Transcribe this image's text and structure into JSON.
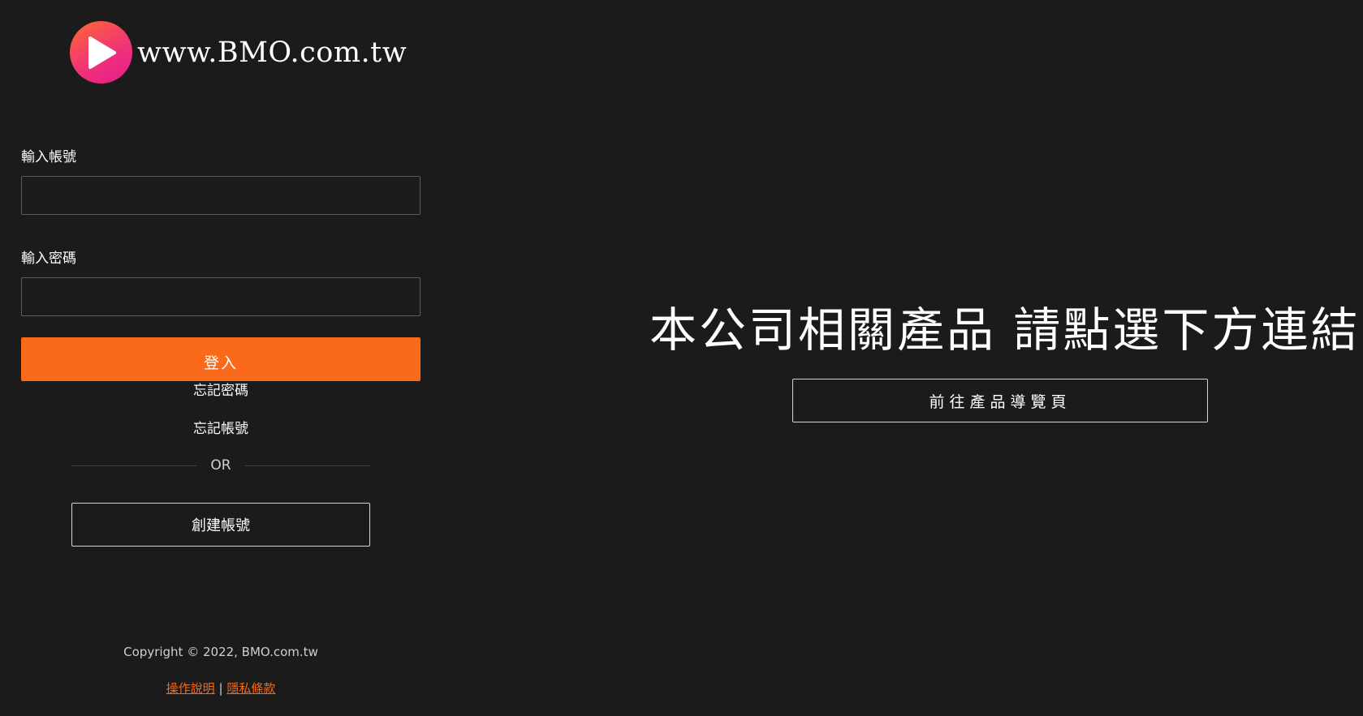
{
  "brand": {
    "logo_icon": "play-icon",
    "site_name": "www.BMO.com.tw"
  },
  "login": {
    "account_label": "輸入帳號",
    "account_value": "",
    "password_label": "輸入密碼",
    "password_value": "",
    "login_button": "登入",
    "forgot_password": "忘記密碼",
    "forgot_account": "忘記帳號",
    "or_text": "OR",
    "create_account_button": "創建帳號"
  },
  "footer": {
    "copyright": "Copyright © 2022, BMO.com.tw",
    "manual_link": "操作說明",
    "separator": "|",
    "privacy_link": "隱私條款"
  },
  "promo": {
    "headline": "本公司相關產品 請點選下方連結",
    "nav_button": "前往產品導覽頁"
  },
  "colors": {
    "background": "#1b1b1b",
    "accent": "#fa6a1a",
    "logo_gradient_start": "#fb6a2f",
    "logo_gradient_end": "#e51c8c"
  }
}
